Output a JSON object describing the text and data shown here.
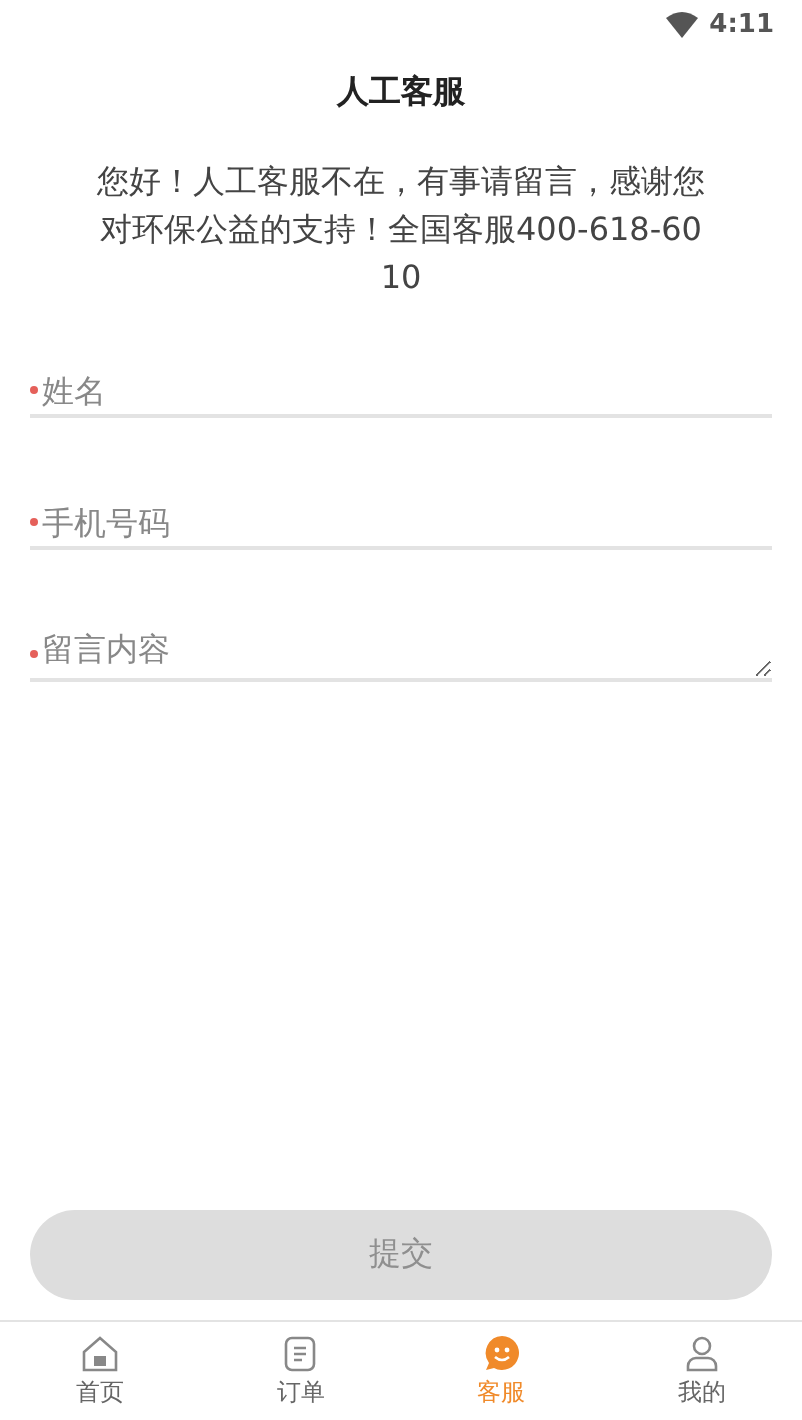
{
  "status_bar": {
    "time": "4:11"
  },
  "title": "人工客服",
  "notice": "您好！人工客服不在，有事请留言，感谢您对环保公益的支持！全国客服400-618-6010",
  "fields": [
    {
      "kind": "input",
      "placeholder": "姓名",
      "required": true
    },
    {
      "kind": "input",
      "placeholder": "手机号码",
      "required": true
    },
    {
      "kind": "textarea",
      "placeholder": "留言内容",
      "required": true
    }
  ],
  "submit": {
    "label": "提交",
    "disabled": true
  },
  "tabs": [
    {
      "label": "首页",
      "selected": false
    },
    {
      "label": "订单",
      "selected": false
    },
    {
      "label": "客服",
      "selected": true
    },
    {
      "label": "我的",
      "selected": false
    }
  ]
}
